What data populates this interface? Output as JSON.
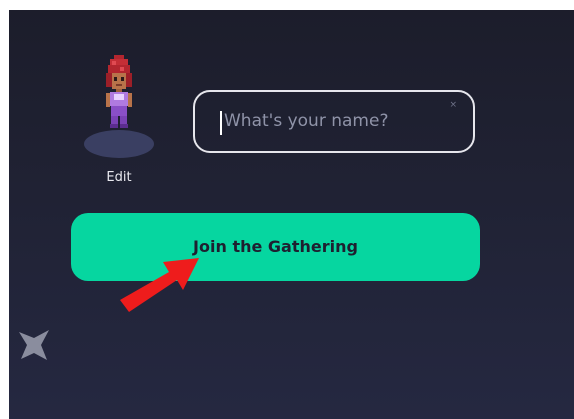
{
  "avatar": {
    "edit_label": "Edit"
  },
  "name_input": {
    "placeholder": "What's your name?",
    "clear_glyph": "×",
    "value": ""
  },
  "join_button": {
    "label": "Join the Gathering"
  },
  "annotation": {
    "arrow_icon": "red-arrow-icon",
    "arrow_color": "#ee1c1c"
  },
  "decoration": {
    "sparkle_icon": "sparkle-icon"
  },
  "colors": {
    "background_top": "#1c1d2b",
    "background_bottom": "#252841",
    "accent": "#06d6a0",
    "input_border": "#e6e6ec"
  }
}
